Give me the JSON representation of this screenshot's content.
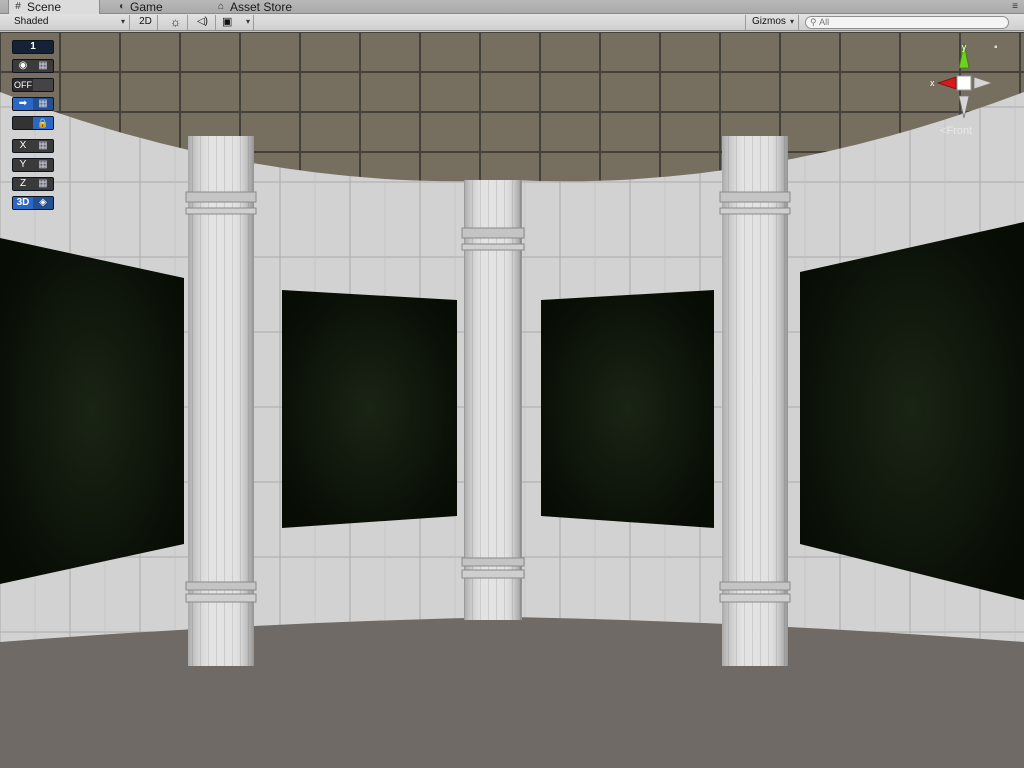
{
  "tabs": [
    {
      "label": "Scene",
      "icon": "grid-icon",
      "glyph": "#",
      "active": true
    },
    {
      "label": "Game",
      "icon": "pacman-icon",
      "glyph": "◖",
      "active": false
    },
    {
      "label": "Asset Store",
      "icon": "shop-icon",
      "glyph": "⌂",
      "active": false
    }
  ],
  "tab_menu_glyph": "≡",
  "toolbar": {
    "shading_mode": "Shaded",
    "mode_2d": "2D",
    "gizmos_label": "Gizmos",
    "search_placeholder": "All",
    "sun_glyph": "☼",
    "audio_glyph": "◁)",
    "image_glyph": "▣",
    "arrow_glyph": "▾"
  },
  "overlay_tools": {
    "layer_number": "1",
    "off_label": "OFF",
    "x_label": "X",
    "y_label": "Y",
    "z_label": "Z",
    "three_d_label": "3D",
    "eye_glyph": "◉",
    "grid_glyph": "▦",
    "lock_glyph": "🔒",
    "arrow_glyph": "➡"
  },
  "gizmo": {
    "y_label": "y",
    "x_label": "x",
    "view_label": "Front",
    "back_glyph": "<"
  },
  "colors": {
    "ceiling": "#7c746a",
    "floor": "#6f6a66",
    "wall": "#dcdcdc",
    "screen": "#0c1508",
    "x_axis": "#d41a1a",
    "y_axis": "#6cd21e"
  }
}
